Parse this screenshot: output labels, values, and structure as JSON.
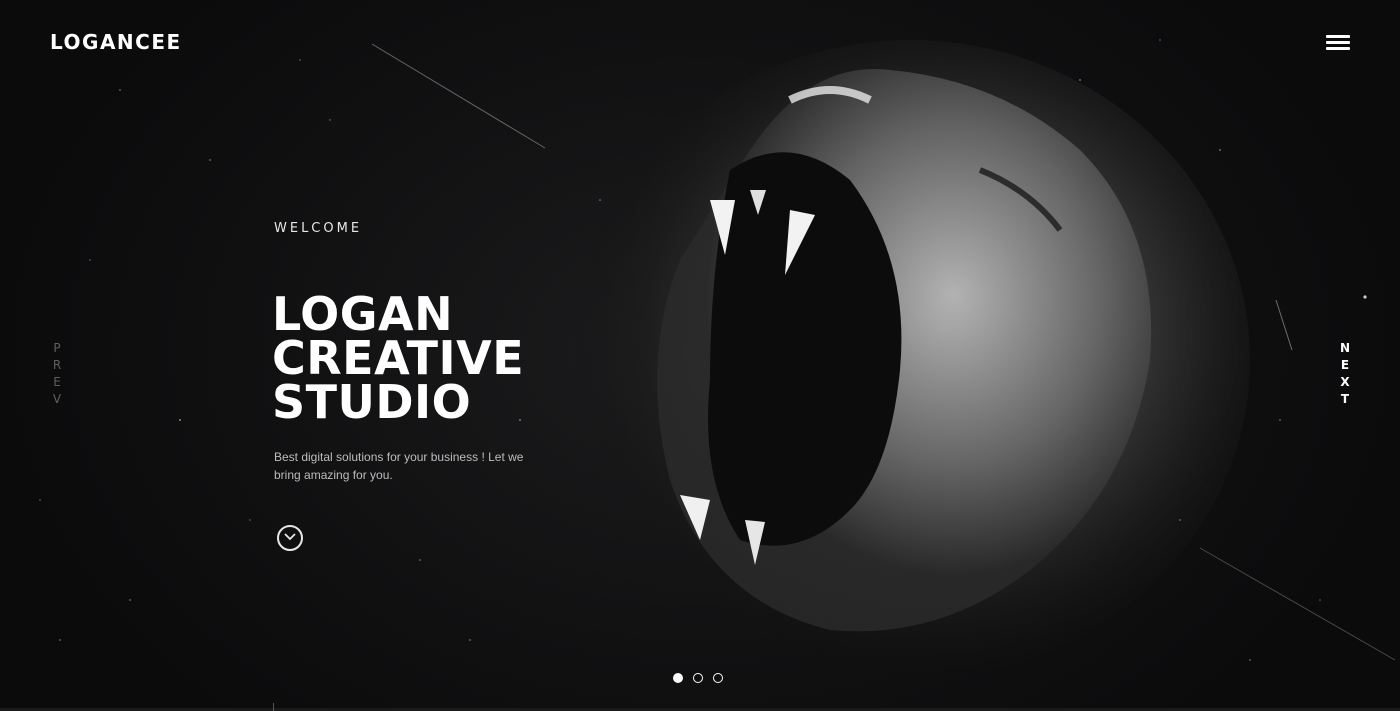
{
  "header": {
    "logo": "LOGANCEE",
    "menu_icon": "hamburger-menu-icon"
  },
  "hero": {
    "kicker": "WELCOME",
    "title_lines": [
      "LOGAN",
      "CREATIVE",
      "STUDIO"
    ],
    "tagline": "Best digital solutions for your business ! Let we bring amazing for you.",
    "scroll_icon": "chevron-down-circle-icon"
  },
  "nav": {
    "prev_letters": [
      "P",
      "R",
      "E",
      "V"
    ],
    "next_letters": [
      "N",
      "E",
      "X",
      "T"
    ]
  },
  "slider": {
    "dot_count": 3,
    "active_index": 0
  },
  "colors": {
    "background": "#0f0f10",
    "text_primary": "#ffffff",
    "text_muted": "#bdbdbd",
    "prev_muted": "#5f5f5f"
  },
  "image": {
    "subject_icon": "roaring-lion-illustration"
  }
}
